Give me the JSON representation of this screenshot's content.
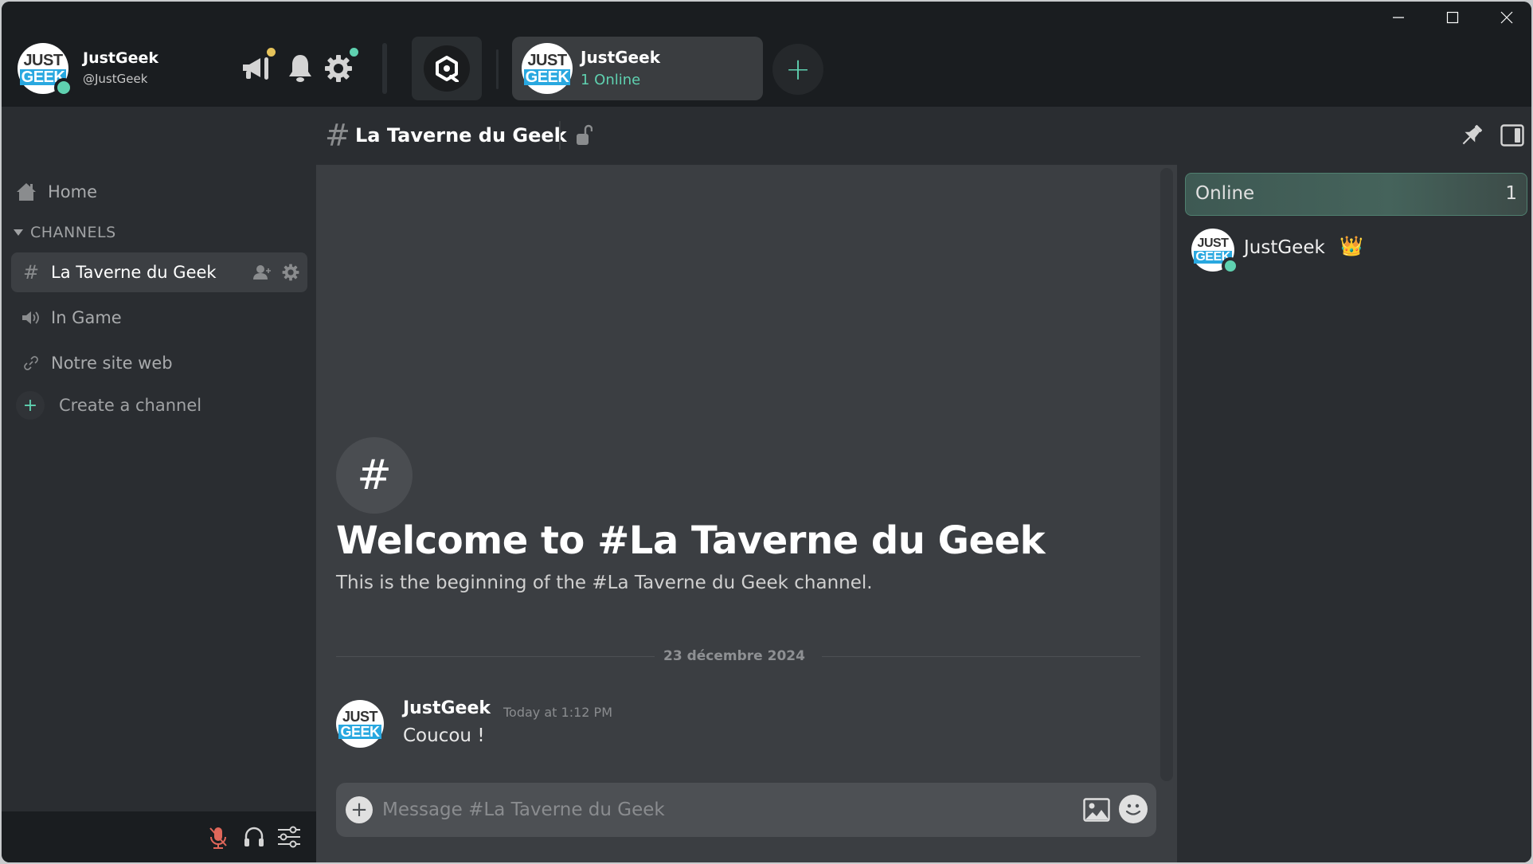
{
  "window": {
    "minimize_icon": "minimize-icon",
    "maximize_icon": "maximize-icon",
    "close_icon": "close-icon"
  },
  "user": {
    "avatar_text_top": "JUST",
    "avatar_text_bottom": "GEEK",
    "display_name": "JustGeek",
    "handle": "@JustGeek",
    "status": "online"
  },
  "topbar": {
    "icons": [
      "megaphone-icon",
      "bell-icon",
      "gear-icon"
    ],
    "explore_icon": "explore-icon",
    "add_server_label": "+"
  },
  "server": {
    "name": "JustGeek",
    "online": "1 Online",
    "avatar_text_top": "JUST",
    "avatar_text_bottom": "GEEK"
  },
  "header": {
    "hash": "#",
    "channel_name": "La Taverne du Geek"
  },
  "sidebar": {
    "home_label": "Home",
    "section_label": "CHANNELS",
    "channels": [
      {
        "type": "text",
        "icon": "#",
        "label": "La Taverne du Geek",
        "active": true
      },
      {
        "type": "voice",
        "icon": "speaker",
        "label": "In Game",
        "active": false
      },
      {
        "type": "link",
        "icon": "link",
        "label": "Notre site web",
        "active": false
      }
    ],
    "create_label": "Create a channel",
    "create_icon": "+"
  },
  "main": {
    "welcome_icon": "#",
    "welcome_title": "Welcome to #La Taverne du Geek",
    "welcome_subtitle": "This is the beginning of the #La Taverne du Geek channel.",
    "date_divider": "23 décembre 2024",
    "messages": [
      {
        "author": "JustGeek",
        "time": "Today at 1:12 PM",
        "text": "Coucou !",
        "avatar_text_top": "JUST",
        "avatar_text_bottom": "GEEK"
      }
    ],
    "composer": {
      "add_icon": "+",
      "placeholder": "Message #La Taverne du Geek",
      "value": ""
    }
  },
  "members": {
    "group_label": "Online",
    "group_count": "1",
    "list": [
      {
        "name": "JustGeek",
        "badge": "👑",
        "avatar_text_top": "JUST",
        "avatar_text_bottom": "GEEK"
      }
    ]
  },
  "colors": {
    "accent": "#5fd1b0",
    "megaphone_dot": "#e6c35a",
    "muted_mic": "#e0675a"
  }
}
